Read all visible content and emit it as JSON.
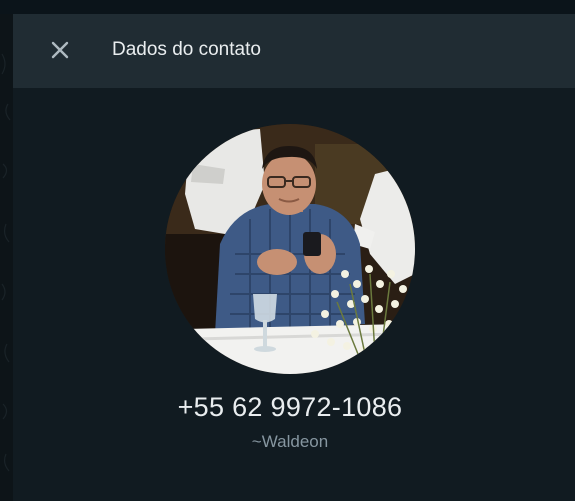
{
  "header": {
    "title": "Dados do contato",
    "close_icon": "close-icon"
  },
  "contact": {
    "avatar": "contact-photo",
    "phone": "+55 62 9972-1086",
    "push_name": "~Waldeon"
  },
  "colors": {
    "header_bg": "#202c33",
    "panel_bg": "#111b21",
    "primary_text": "#e9edef",
    "secondary_text": "#8696a0",
    "icon": "#aebac1"
  }
}
